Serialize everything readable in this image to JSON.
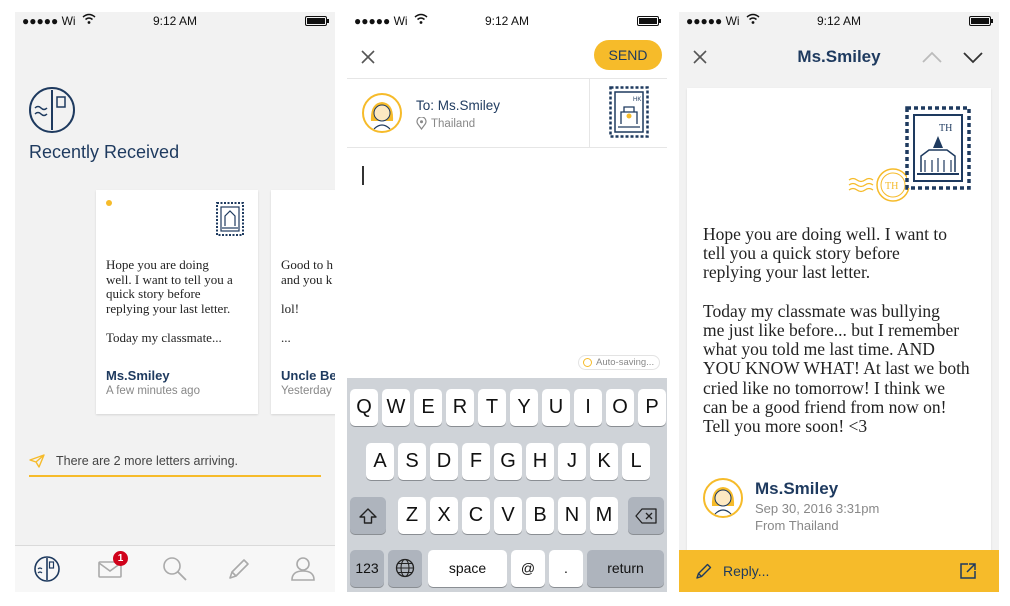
{
  "status_bar": {
    "carrier": "●●●●● Wi",
    "time": "9:12 AM"
  },
  "inbox": {
    "title": "Recently Received",
    "cards": [
      {
        "unread": true,
        "preview": "Hope you are doing\nwell. I want to tell you a\nquick story before\nreplying your last letter.\n\nToday my classmate...",
        "sender": "Ms.Smiley",
        "time": "A few minutes ago"
      },
      {
        "unread": false,
        "preview": "Good to h\nand you k\n\nlol!\n\n...",
        "sender": "Uncle Be",
        "time": "Yesterday"
      }
    ],
    "notice": "There are 2 more letters arriving.",
    "tabs": [
      {
        "icon": "letterbox-icon",
        "active": true
      },
      {
        "icon": "mail-icon",
        "badge": "1"
      },
      {
        "icon": "search-icon"
      },
      {
        "icon": "pencil-icon"
      },
      {
        "icon": "profile-icon"
      }
    ]
  },
  "compose": {
    "send_label": "SEND",
    "to_label": "To: Ms.Smiley",
    "country": "Thailand",
    "stamp_code": "HK",
    "autosave_label": "Auto-saving...",
    "keyboard": {
      "row1": [
        "Q",
        "W",
        "E",
        "R",
        "T",
        "Y",
        "U",
        "I",
        "O",
        "P"
      ],
      "row2": [
        "A",
        "S",
        "D",
        "F",
        "G",
        "H",
        "J",
        "K",
        "L"
      ],
      "row3": [
        "Z",
        "X",
        "C",
        "V",
        "B",
        "N",
        "M"
      ],
      "numbers_label": "123",
      "space_label": "space",
      "at_label": "@",
      "dot_label": ".",
      "return_label": "return"
    }
  },
  "reader": {
    "title": "Ms.Smiley",
    "stamp_code": "TH",
    "postmark_code": "TH",
    "body": "Hope you are doing well. I want to\ntell you a quick story before\nreplying your last letter.\n\nToday my classmate was bullying\nme just like before... but I remember\nwhat you told me last time. AND\nYOU KNOW WHAT! At last we both\ncried like no tomorrow! I think we\ncan be a good friend from now on!\nTell you more soon! <3",
    "sender": "Ms.Smiley",
    "date": "Sep 30, 2016 3:31pm",
    "from": "From Thailand",
    "reply_label": "Reply..."
  },
  "colors": {
    "accent": "#f6bb2a",
    "navy": "#1e3a5f",
    "badge": "#d0021b"
  }
}
